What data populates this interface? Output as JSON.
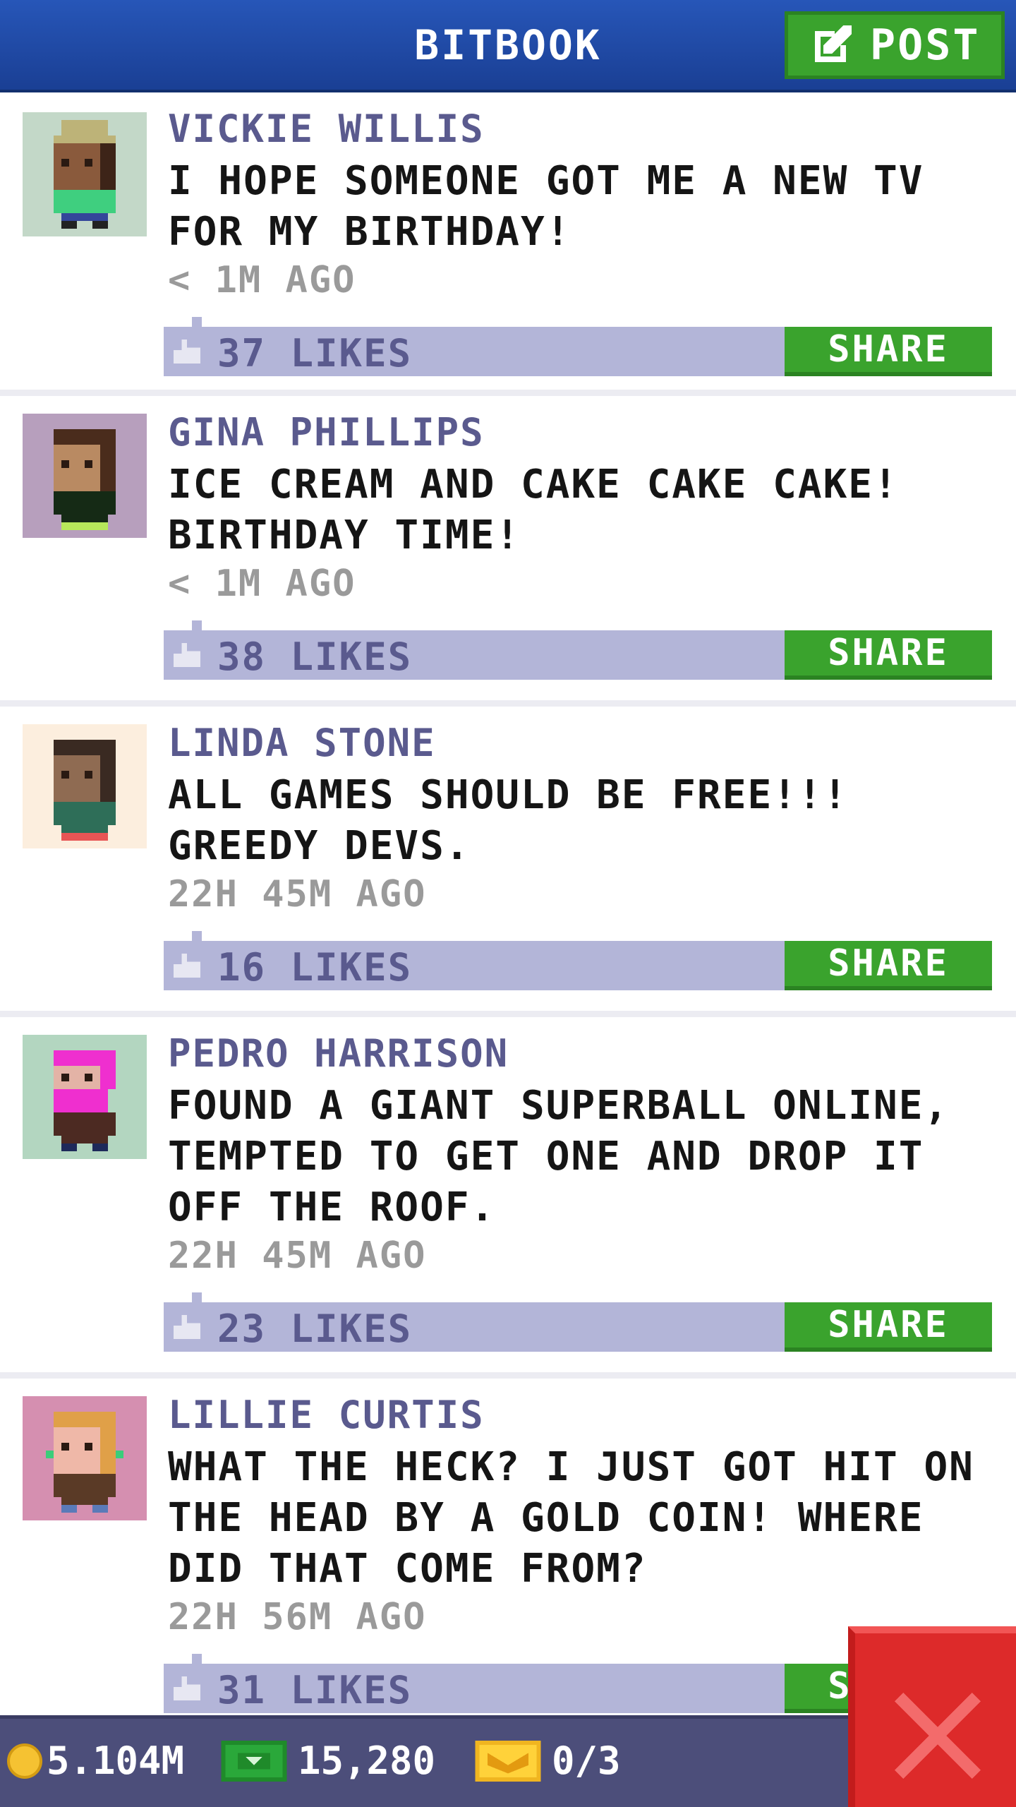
{
  "header": {
    "title": "BITBOOK",
    "post_label": "POST",
    "post_icon": "edit-icon"
  },
  "posts": [
    {
      "author": "VICKIE WILLIS",
      "message": "I HOPE SOMEONE GOT ME A NEW TV FOR MY BIRTHDAY!",
      "time": "< 1M AGO",
      "likes": "37 LIKES",
      "share_label": "SHARE",
      "avatar_bg": "#c3d8c8"
    },
    {
      "author": "GINA PHILLIPS",
      "message": "ICE CREAM AND CAKE CAKE CAKE! BIRTHDAY TIME!",
      "time": "< 1M AGO",
      "likes": "38 LIKES",
      "share_label": "SHARE",
      "avatar_bg": "#b79fbd"
    },
    {
      "author": "LINDA STONE",
      "message": "ALL GAMES SHOULD BE FREE!!! GREEDY DEVS.",
      "time": "22H 45M AGO",
      "likes": "16 LIKES",
      "share_label": "SHARE",
      "avatar_bg": "#fceede"
    },
    {
      "author": "PEDRO HARRISON",
      "message": "FOUND A GIANT SUPERBALL ONLINE, TEMPTED TO GET ONE AND DROP IT OFF THE ROOF.",
      "time": "22H 45M AGO",
      "likes": "23 LIKES",
      "share_label": "SHARE",
      "avatar_bg": "#b3d6c0"
    },
    {
      "author": "LILLIE CURTIS",
      "message": "WHAT THE HECK? I JUST GOT HIT ON THE HEAD BY A GOLD COIN! WHERE DID THAT COME FROM?",
      "time": "22H 56M AGO",
      "likes": "31 LIKES",
      "share_label": "SHARE",
      "avatar_bg": "#d58fb0"
    }
  ],
  "status": {
    "coins": "5.104M",
    "bux": "15,280",
    "tickets": "0/3"
  },
  "colors": {
    "header": "#2756b8",
    "accent_green": "#3aa32d",
    "like_bar": "#b3b5d8",
    "close_red": "#dd2a2a"
  }
}
